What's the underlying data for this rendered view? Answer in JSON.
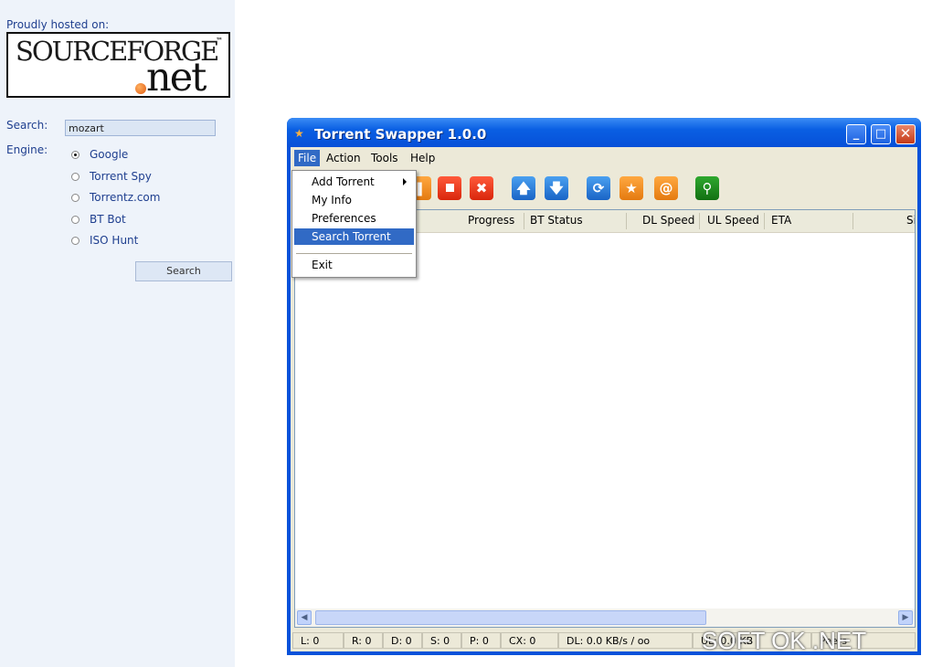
{
  "left_panel": {
    "hosted_text": "Proudly hosted on:",
    "logo": {
      "top_text": "SOURCEFORGE",
      "tm": "™",
      "bottom_text": "net"
    },
    "search_label": "Search:",
    "search_value": "mozart",
    "engine_label": "Engine:",
    "engines": [
      {
        "label": "Google",
        "selected": true
      },
      {
        "label": "Torrent Spy",
        "selected": false
      },
      {
        "label": "Torrentz.com",
        "selected": false
      },
      {
        "label": "BT Bot",
        "selected": false
      },
      {
        "label": "ISO Hunt",
        "selected": false
      }
    ],
    "search_button": "Search"
  },
  "window": {
    "title": "Torrent Swapper 1.0.0",
    "minimize": "_",
    "maximize": "□",
    "close": "✕",
    "menus": [
      "File",
      "Action",
      "Tools",
      "Help"
    ],
    "columns": [
      "Progress",
      "BT Status",
      "DL Speed",
      "UL Speed",
      "ETA",
      "Si"
    ],
    "status": [
      "L: 0",
      "R: 0",
      "D: 0",
      "S: 0",
      "P: 0",
      "CX: 0",
      "DL: 0.0 KB/s / oo",
      "UL: 0.0 KB",
      "Peers"
    ]
  },
  "file_menu": {
    "items": [
      "Add Torrent",
      "My Info",
      "Preferences",
      "Search Torrent"
    ],
    "exit": "Exit",
    "highlighted": "Search Torrent"
  },
  "toolbar_icons": [
    "pause-icon",
    "stop-icon",
    "remove-icon",
    "move-up-icon",
    "move-down-icon",
    "refresh-icon",
    "favorite-icon",
    "email-icon",
    "search-icon"
  ],
  "watermark": "SOFT OK .NET",
  "colors": {
    "titlebar": "#0a5fe3",
    "highlight": "#316ac5",
    "panel_bg": "#eef3fa"
  }
}
